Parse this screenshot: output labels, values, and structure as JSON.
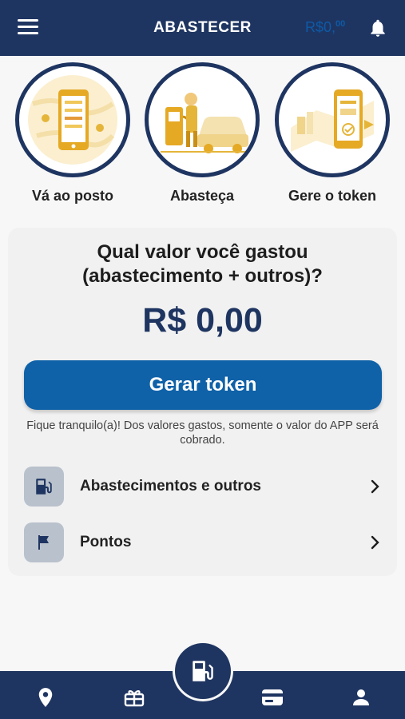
{
  "header": {
    "title": "ABASTECER",
    "balance_main": "R$0,",
    "balance_cents": "00",
    "menu_icon": "hamburger-menu-icon",
    "bell_icon": "bell-icon"
  },
  "steps": [
    {
      "label": "Vá ao posto",
      "icon": "phone-map-illustration"
    },
    {
      "label": "Abasteça",
      "icon": "fuel-pump-car-illustration"
    },
    {
      "label": "Gere o token",
      "icon": "phone-token-illustration"
    }
  ],
  "card": {
    "question_line1": "Qual valor você gastou",
    "question_line2": "(abastecimento + outros)?",
    "amount": "R$ 0,00",
    "button_label": "Gerar token",
    "note": "Fique tranquilo(a)! Dos valores gastos, somente o valor do APP será cobrado."
  },
  "list": [
    {
      "label": "Abastecimentos e outros",
      "icon": "fuel-pump-icon"
    },
    {
      "label": "Pontos",
      "icon": "flag-icon"
    }
  ],
  "bottom_nav": {
    "items": [
      "location-pin-icon",
      "gift-icon",
      "fuel-pump-icon",
      "wallet-card-icon",
      "user-icon"
    ]
  },
  "colors": {
    "primary": "#1f3561",
    "button": "#0f62a8",
    "accent": "#e5b53a"
  }
}
